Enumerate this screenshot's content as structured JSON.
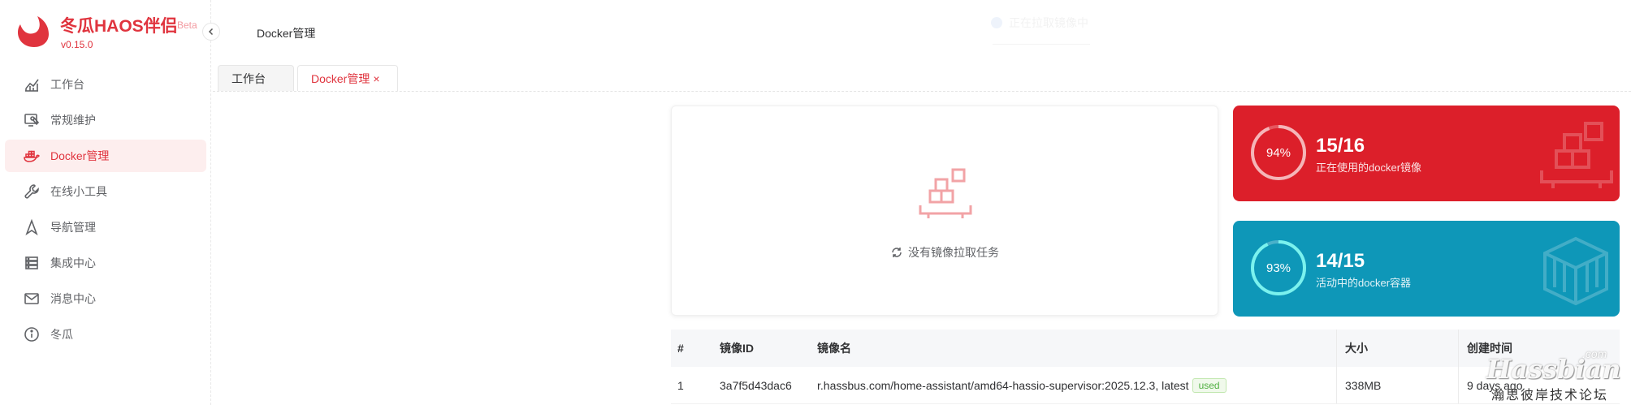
{
  "brand": {
    "title": "冬瓜HAOS伴侣",
    "badge": "Beta",
    "version": "v0.15.0",
    "color": "#e0343e"
  },
  "header": {
    "title": "Docker管理",
    "faint_status": "正在拉取镜像中"
  },
  "sidebar": {
    "items": [
      {
        "label": "工作台",
        "icon": "chart-line-icon",
        "active": false
      },
      {
        "label": "常规维护",
        "icon": "maintenance-icon",
        "active": false
      },
      {
        "label": "Docker管理",
        "icon": "docker-icon",
        "active": true
      },
      {
        "label": "在线小工具",
        "icon": "wrench-icon",
        "active": false
      },
      {
        "label": "导航管理",
        "icon": "navigation-icon",
        "active": false
      },
      {
        "label": "集成中心",
        "icon": "server-icon",
        "active": false
      },
      {
        "label": "消息中心",
        "icon": "mail-icon",
        "active": false
      },
      {
        "label": "冬瓜",
        "icon": "info-icon",
        "active": false
      }
    ]
  },
  "tabs": [
    {
      "label": "工作台",
      "active": false
    },
    {
      "label": "Docker管理",
      "active": true,
      "close": "×"
    }
  ],
  "pull_tasks": {
    "empty_text": "没有镜像拉取任务"
  },
  "stats": [
    {
      "percent_label": "94%",
      "percent": 94,
      "value": "15/16",
      "label": "正在使用的docker镜像",
      "color": "#dc1f2a"
    },
    {
      "percent_label": "93%",
      "percent": 93,
      "value": "14/15",
      "label": "活动中的docker容器",
      "color": "#0e97b8"
    }
  ],
  "table": {
    "headers": {
      "idx": "#",
      "id": "镜像ID",
      "name": "镜像名",
      "size": "大小",
      "time": "创建时间"
    },
    "rows": [
      {
        "idx": "1",
        "id": "3a7f5d43dac6",
        "name": "r.hassbus.com/home-assistant/amd64-hassio-supervisor:2025.12.3, latest",
        "badge": "used",
        "size": "338MB",
        "time": "9 days ago"
      }
    ]
  },
  "watermark": {
    "brand": "Hassbian",
    "suffix": ".com",
    "subtitle": "瀚思彼岸技术论坛"
  }
}
